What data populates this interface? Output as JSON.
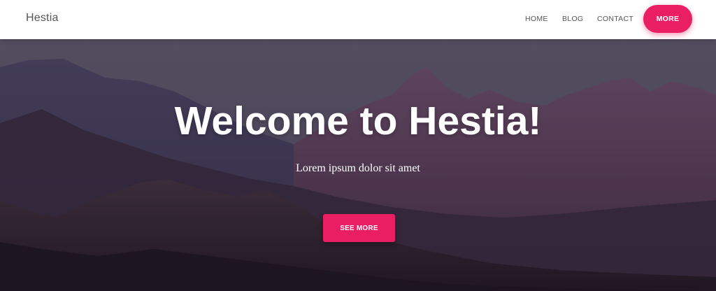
{
  "navbar": {
    "brand": "Hestia",
    "links": [
      {
        "label": "HOME"
      },
      {
        "label": "BLOG"
      },
      {
        "label": "CONTACT"
      }
    ],
    "more_button": "MORE"
  },
  "hero": {
    "title": "Welcome to Hestia!",
    "subtitle": "Lorem ipsum dolor sit amet",
    "button": "SEE MORE",
    "background_image": "mountain-range-dusk"
  },
  "colors": {
    "accent": "#e91e63",
    "nav_text": "#555555",
    "hero_text": "#ffffff"
  }
}
